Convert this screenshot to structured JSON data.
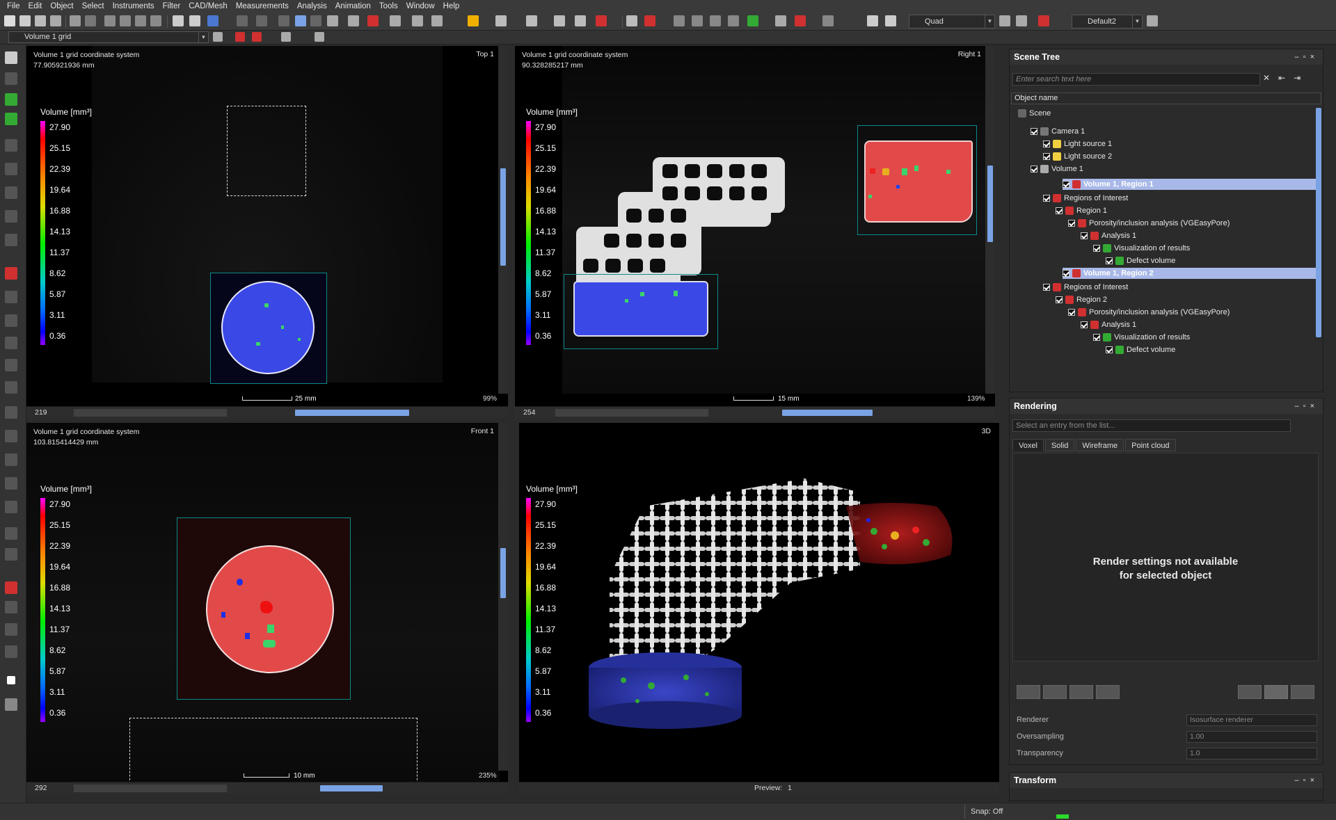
{
  "menu": [
    "File",
    "Edit",
    "Object",
    "Select",
    "Instruments",
    "Filter",
    "CAD/Mesh",
    "Measurements",
    "Analysis",
    "Animation",
    "Tools",
    "Window",
    "Help"
  ],
  "toolbar": {
    "layout_combo": "Quad",
    "profile_combo": "Default2",
    "object_combo": "Volume 1 grid"
  },
  "colorbar": {
    "title": "Volume [mm³]",
    "ticks": [
      "27.90",
      "25.15",
      "22.39",
      "19.64",
      "16.88",
      "14.13",
      "11.37",
      "8.62",
      "5.87",
      "3.11",
      "0.36"
    ]
  },
  "views": {
    "top": {
      "coord": "Volume 1 grid coordinate system",
      "pos": "77.905921936 mm",
      "name": "Top 1",
      "slice": "219",
      "scale": "25 mm",
      "zoom": "99%"
    },
    "right": {
      "coord": "Volume 1 grid coordinate system",
      "pos": "90.328285217 mm",
      "name": "Right 1",
      "slice": "254",
      "scale": "15 mm",
      "zoom": "139%"
    },
    "front": {
      "coord": "Volume 1 grid coordinate system",
      "pos": "103.815414429 mm",
      "name": "Front 1",
      "slice": "292",
      "scale": "10 mm",
      "zoom": "235%"
    },
    "three_d": {
      "name": "3D",
      "preview_label": "Preview:",
      "preview_value": "1"
    }
  },
  "scene_tree": {
    "title": "Scene Tree",
    "search_placeholder": "Enter search text here",
    "column": "Object name",
    "items": [
      {
        "label": "Scene",
        "indent": 0,
        "sel": false,
        "icon": "#666"
      },
      {
        "label": "Camera 1",
        "indent": 1,
        "sel": false,
        "icon": "#777"
      },
      {
        "label": "Light source 1",
        "indent": 2,
        "sel": false,
        "icon": "#f0d040"
      },
      {
        "label": "Light source 2",
        "indent": 2,
        "sel": false,
        "icon": "#f0d040"
      },
      {
        "label": "Volume 1",
        "indent": 1,
        "sel": false,
        "icon": "#aaa"
      },
      {
        "label": "Volume 1, Region 1",
        "indent": 1,
        "sel": true,
        "icon": "#d03030"
      },
      {
        "label": "Regions of Interest",
        "indent": 2,
        "sel": false,
        "icon": "#d03030"
      },
      {
        "label": "Region 1",
        "indent": 3,
        "sel": false,
        "icon": "#d03030"
      },
      {
        "label": "Porosity/inclusion analysis (VGEasyPore)",
        "indent": 4,
        "sel": false,
        "icon": "#d03030"
      },
      {
        "label": "Analysis 1",
        "indent": 5,
        "sel": false,
        "icon": "#d03030"
      },
      {
        "label": "Visualization of results",
        "indent": 6,
        "sel": false,
        "icon": "#3a3"
      },
      {
        "label": "Defect volume",
        "indent": 7,
        "sel": false,
        "icon": "#3a3"
      },
      {
        "label": "Volume 1, Region 2",
        "indent": 1,
        "sel": true,
        "icon": "#d03030"
      },
      {
        "label": "Regions of Interest",
        "indent": 2,
        "sel": false,
        "icon": "#d03030"
      },
      {
        "label": "Region 2",
        "indent": 3,
        "sel": false,
        "icon": "#d03030"
      },
      {
        "label": "Porosity/inclusion analysis (VGEasyPore)",
        "indent": 4,
        "sel": false,
        "icon": "#d03030"
      },
      {
        "label": "Analysis 1",
        "indent": 5,
        "sel": false,
        "icon": "#d03030"
      },
      {
        "label": "Visualization of results",
        "indent": 6,
        "sel": false,
        "icon": "#3a3"
      },
      {
        "label": "Defect volume",
        "indent": 7,
        "sel": false,
        "icon": "#3a3"
      }
    ]
  },
  "rendering": {
    "title": "Rendering",
    "select_placeholder": "Select an entry from the list...",
    "tabs": [
      "Voxel",
      "Solid",
      "Wireframe",
      "Point cloud"
    ],
    "message_line1": "Render settings not available",
    "message_line2": "for selected object",
    "props": [
      {
        "key": "Renderer",
        "value": "Isosurface renderer"
      },
      {
        "key": "Oversampling",
        "value": "1.00"
      },
      {
        "key": "Transparency",
        "value": "1.0"
      }
    ]
  },
  "transform": {
    "title": "Transform"
  },
  "status": {
    "snap": "Snap: Off"
  }
}
